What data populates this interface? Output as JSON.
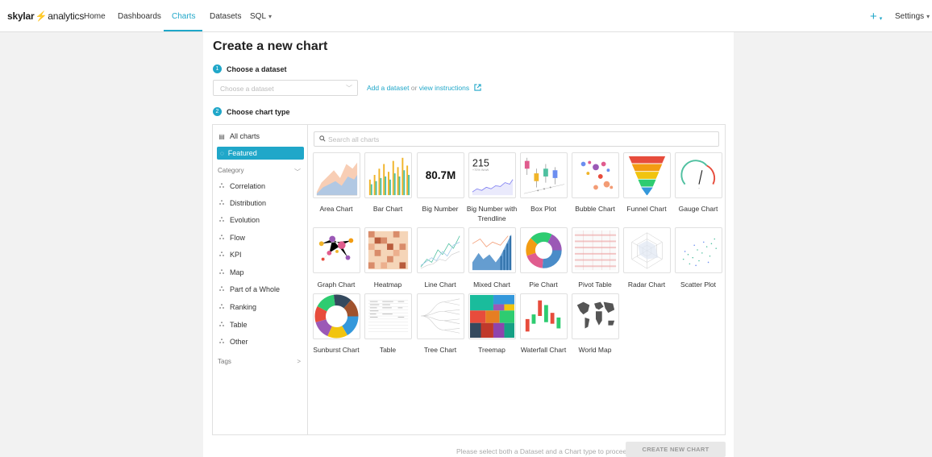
{
  "nav": {
    "brand_part1": "skylar",
    "brand_part2": "analytics",
    "items": [
      "Home",
      "Dashboards",
      "Charts",
      "Datasets",
      "SQL"
    ],
    "active": "Charts",
    "plus": "+",
    "settings": "Settings"
  },
  "page": {
    "title": "Create a new chart",
    "step1": {
      "num": "1",
      "label": "Choose a dataset"
    },
    "dataset_placeholder": "Choose a dataset",
    "add_dataset": "Add a dataset",
    "or": "or",
    "view_instructions": "view instructions",
    "step2": {
      "num": "2",
      "label": "Choose chart type"
    }
  },
  "sidebar": {
    "all_charts": "All charts",
    "featured": "Featured",
    "category_header": "Category",
    "categories": [
      "Correlation",
      "Distribution",
      "Evolution",
      "Flow",
      "KPI",
      "Map",
      "Part of a Whole",
      "Ranking",
      "Table",
      "Other"
    ],
    "tags_header": "Tags"
  },
  "search_placeholder": "Search all charts",
  "charts": [
    {
      "label": "Area Chart",
      "icon": "area-chart-thumb"
    },
    {
      "label": "Bar Chart",
      "icon": "bar-chart-thumb"
    },
    {
      "label": "Big Number",
      "icon": "big-number-thumb",
      "value": "80.7M"
    },
    {
      "label": "Big Number with Trendline",
      "icon": "big-number-trendline-thumb",
      "value": "215",
      "sub": "+70% WoW"
    },
    {
      "label": "Box Plot",
      "icon": "box-plot-thumb"
    },
    {
      "label": "Bubble Chart",
      "icon": "bubble-chart-thumb"
    },
    {
      "label": "Funnel Chart",
      "icon": "funnel-chart-thumb"
    },
    {
      "label": "Gauge Chart",
      "icon": "gauge-chart-thumb"
    },
    {
      "label": "Graph Chart",
      "icon": "graph-chart-thumb"
    },
    {
      "label": "Heatmap",
      "icon": "heatmap-thumb"
    },
    {
      "label": "Line Chart",
      "icon": "line-chart-thumb"
    },
    {
      "label": "Mixed Chart",
      "icon": "mixed-chart-thumb"
    },
    {
      "label": "Pie Chart",
      "icon": "pie-chart-thumb"
    },
    {
      "label": "Pivot Table",
      "icon": "pivot-table-thumb"
    },
    {
      "label": "Radar Chart",
      "icon": "radar-chart-thumb"
    },
    {
      "label": "Scatter Plot",
      "icon": "scatter-plot-thumb"
    },
    {
      "label": "Sunburst Chart",
      "icon": "sunburst-chart-thumb"
    },
    {
      "label": "Table",
      "icon": "table-thumb"
    },
    {
      "label": "Tree Chart",
      "icon": "tree-chart-thumb"
    },
    {
      "label": "Treemap",
      "icon": "treemap-thumb"
    },
    {
      "label": "Waterfall Chart",
      "icon": "waterfall-chart-thumb"
    },
    {
      "label": "World Map",
      "icon": "world-map-thumb"
    }
  ],
  "footer": {
    "hint": "Please select both a Dataset and a Chart type to proceed",
    "create_button": "CREATE NEW CHART"
  },
  "colors": {
    "accent": "#20a7c9",
    "brand_bolt": "#e8a500"
  }
}
